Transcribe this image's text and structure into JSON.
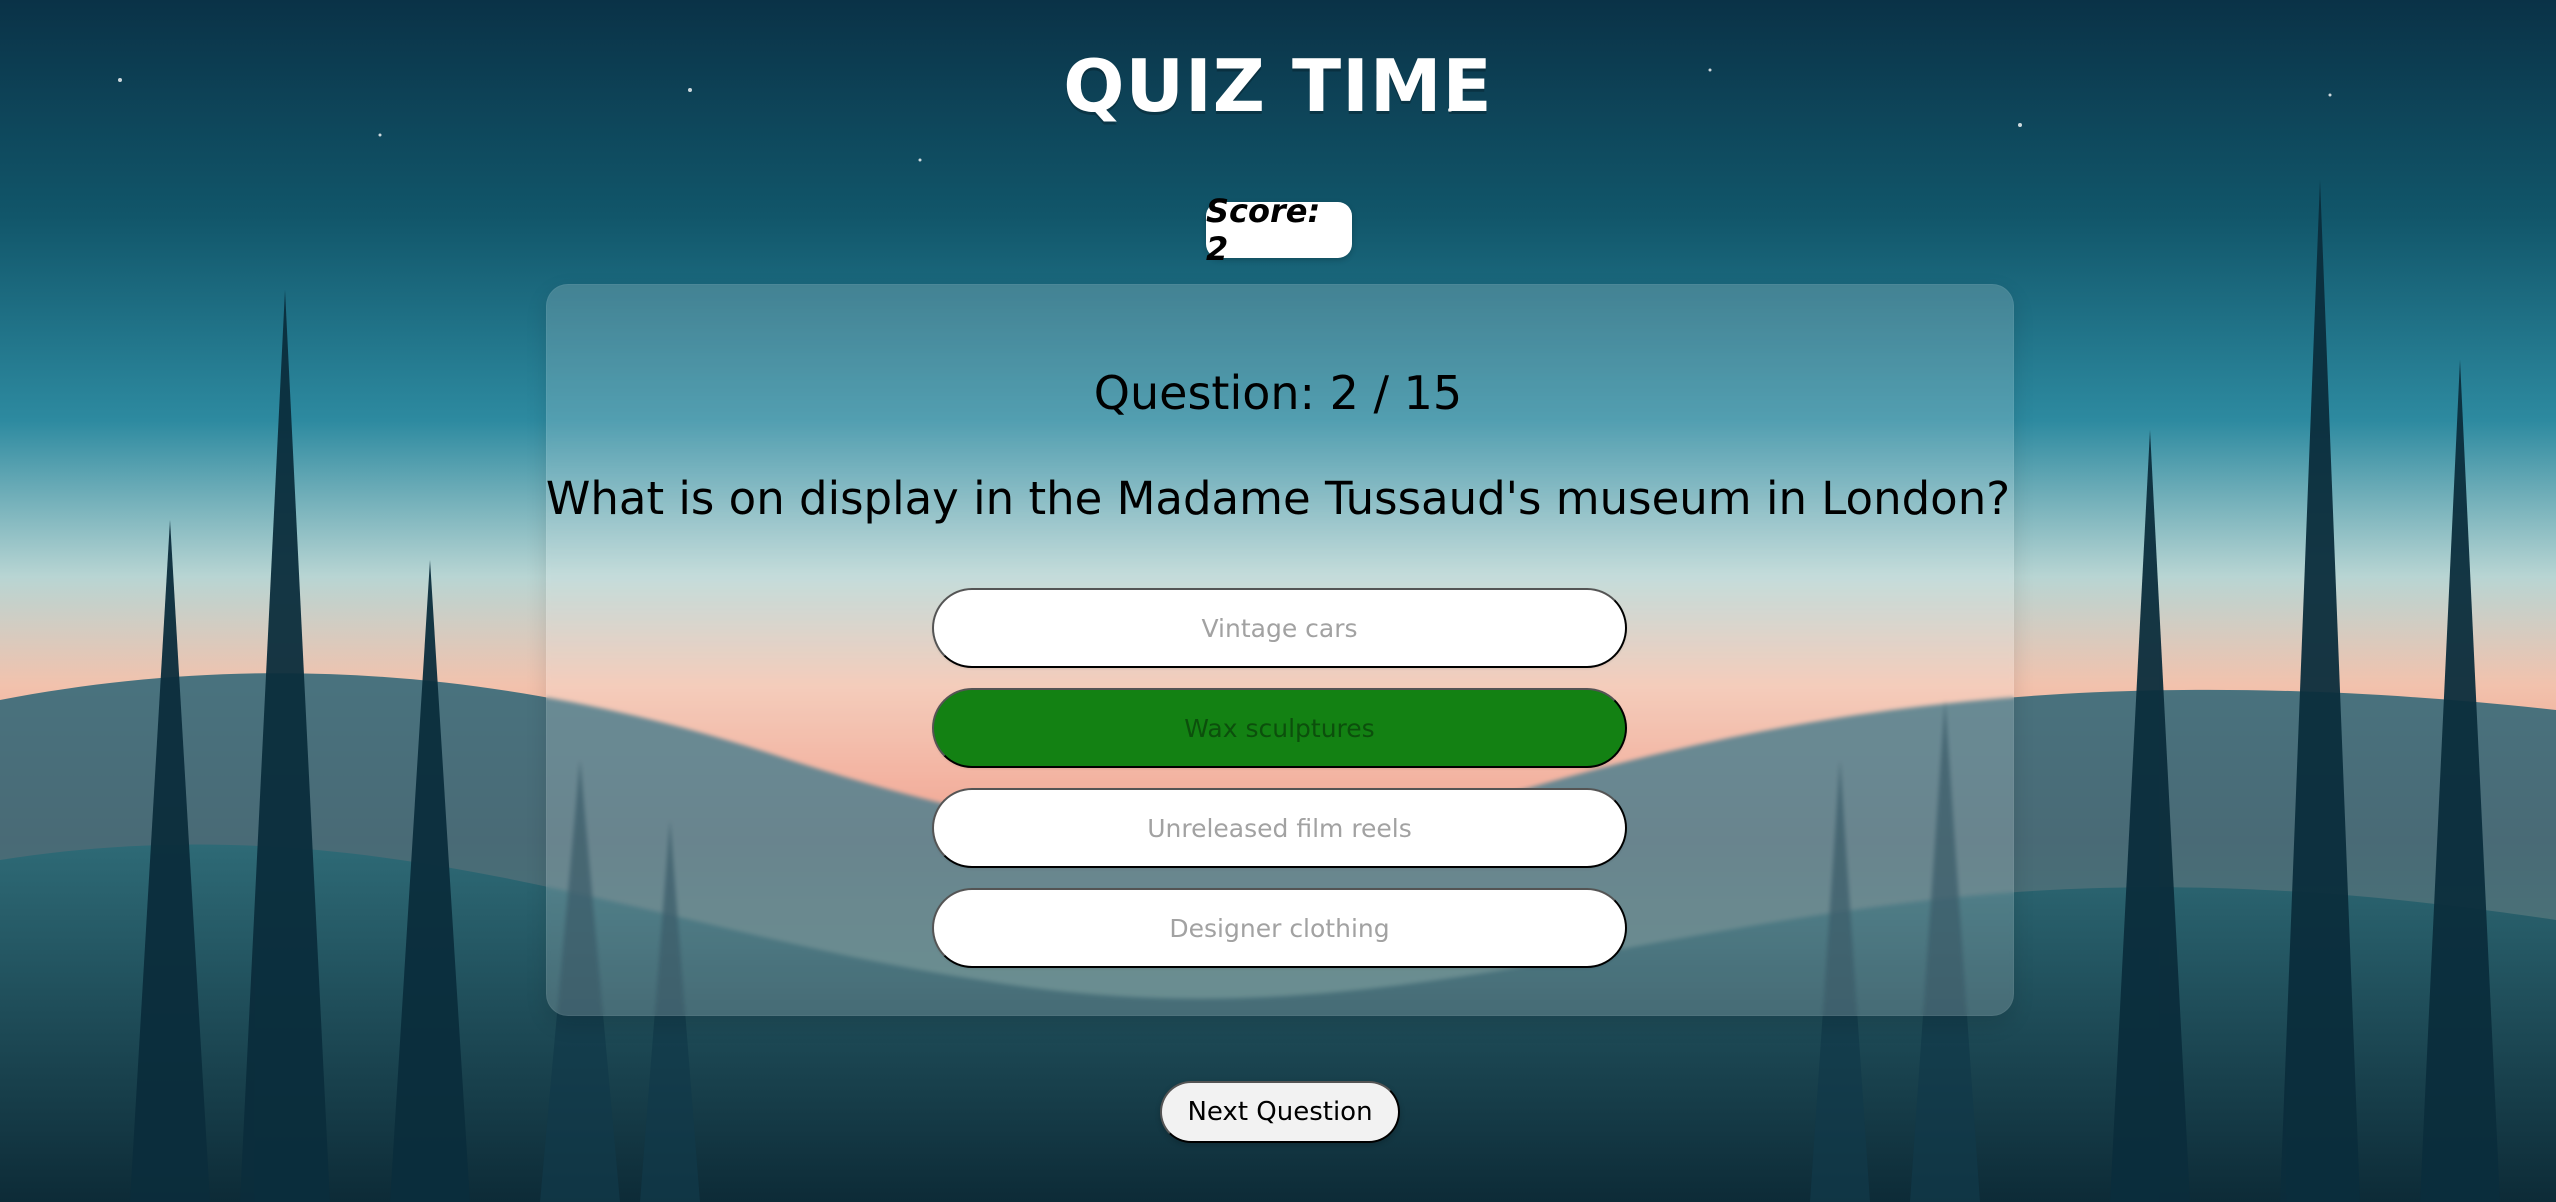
{
  "quiz": {
    "title": "QUIZ TIME",
    "score_text": "Score: 2",
    "question_counter": "Question: 2 / 15",
    "question": "What is on display in the Madame Tussaud's museum in London?",
    "answers": [
      {
        "label": "Vintage cars",
        "state": "default"
      },
      {
        "label": "Wax sculptures",
        "state": "correct"
      },
      {
        "label": "Unreleased film reels",
        "state": "default"
      },
      {
        "label": "Designer clothing",
        "state": "default"
      }
    ],
    "next_button": "Next Question"
  },
  "colors": {
    "correct_answer": "#138113",
    "answer_default": "#ffffff",
    "answer_text": "#a2a2a2"
  },
  "background": {
    "type": "forest-sky-illustration"
  }
}
